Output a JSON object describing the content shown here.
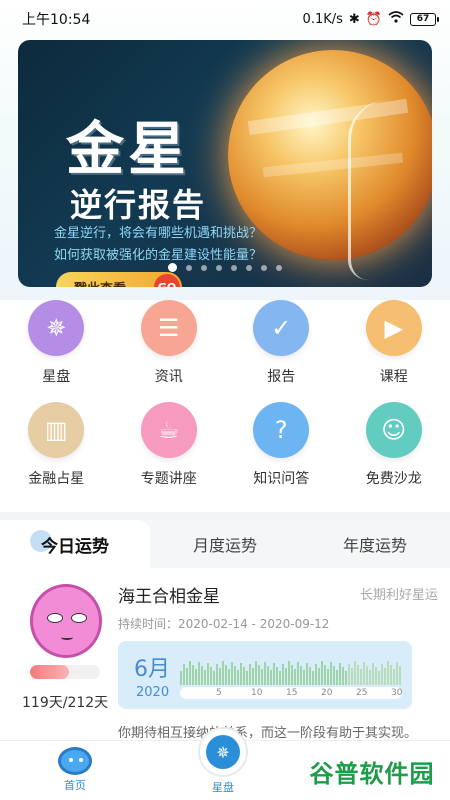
{
  "status_bar": {
    "time": "上午10:54",
    "network_speed": "0.1K/s",
    "battery": "67"
  },
  "banner": {
    "title": "金星",
    "subtitle": "逆行报告",
    "line1": "金星逆行，将会有哪些机遇和挑战？",
    "line2": "如何获取被强化的金星建设性能量？",
    "button_label": "戳此查看",
    "go_label": "GO",
    "slides": 8,
    "active_slide": 0
  },
  "menu": [
    {
      "label": "星盘",
      "icon": "compass-icon",
      "color": "#b48ee6",
      "glyph": "✵"
    },
    {
      "label": "资讯",
      "icon": "document-icon",
      "color": "#f6a693",
      "glyph": "☰"
    },
    {
      "label": "报告",
      "icon": "clipboard-check-icon",
      "color": "#84b7ef",
      "glyph": "✓"
    },
    {
      "label": "课程",
      "icon": "play-book-icon",
      "color": "#f5be70",
      "glyph": "▶"
    },
    {
      "label": "金融占星",
      "icon": "bar-chart-icon",
      "color": "#e6cda3",
      "glyph": "▥"
    },
    {
      "label": "专题讲座",
      "icon": "cup-icon",
      "color": "#f79ac0",
      "glyph": "☕"
    },
    {
      "label": "知识问答",
      "icon": "question-icon",
      "color": "#6db5f2",
      "glyph": "?"
    },
    {
      "label": "免费沙龙",
      "icon": "person-card-icon",
      "color": "#62ccc1",
      "glyph": "☺"
    }
  ],
  "tabs": [
    {
      "label": "今日运势",
      "active": true
    },
    {
      "label": "月度运势",
      "active": false
    },
    {
      "label": "年度运势",
      "active": false
    }
  ],
  "fortune": {
    "title": "海王合相金星",
    "tag": "长期利好星运",
    "duration": "持续时间：2020-02-14 - 2020-09-12",
    "days": "119天/212天",
    "progress": 0.56,
    "month": "6月",
    "year": "2020",
    "axis_ticks": [
      "5",
      "10",
      "15",
      "20",
      "25",
      "30"
    ],
    "description": "你期待相互接纳的关系，而这一阶段有助于其实现。"
  },
  "bottom_nav": {
    "home_label": "首页",
    "chart_label": "星盘"
  },
  "watermark": "谷普软件园",
  "colors": {
    "accent": "#2b8fd8",
    "banner_button": "#f3a72e",
    "go_button": "#e8452f"
  }
}
